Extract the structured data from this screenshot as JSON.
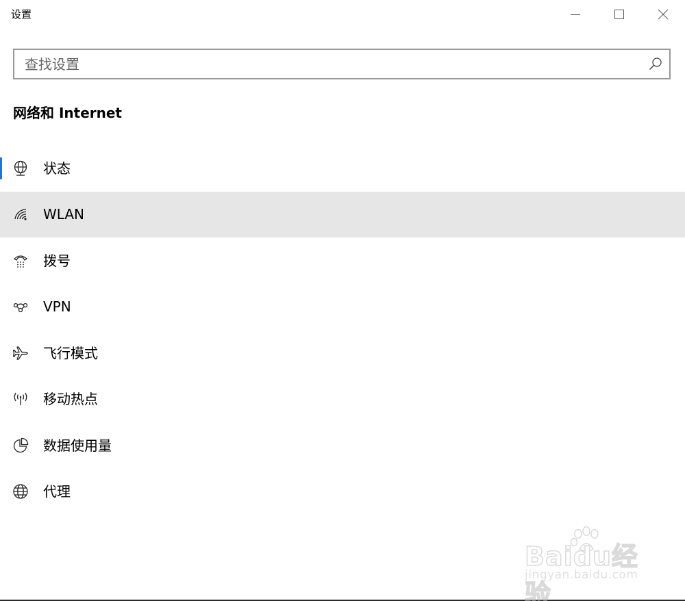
{
  "window": {
    "title": "设置",
    "controls": {
      "minimize_icon": "minimize-icon",
      "maximize_icon": "maximize-icon",
      "close_icon": "close-icon"
    }
  },
  "search": {
    "value": "",
    "placeholder": "查找设置",
    "icon": "search-icon"
  },
  "section": {
    "title": "网络和 Internet"
  },
  "nav": {
    "items": [
      {
        "label": "状态",
        "icon": "network-status-icon",
        "selected": true
      },
      {
        "label": "WLAN",
        "icon": "wifi-icon",
        "hovered": true
      },
      {
        "label": "拨号",
        "icon": "dialup-icon"
      },
      {
        "label": "VPN",
        "icon": "vpn-icon"
      },
      {
        "label": "飞行模式",
        "icon": "airplane-icon"
      },
      {
        "label": "移动热点",
        "icon": "hotspot-icon"
      },
      {
        "label": "数据使用量",
        "icon": "data-usage-icon"
      },
      {
        "label": "代理",
        "icon": "globe-icon"
      }
    ]
  },
  "watermark": {
    "logo": "Baidu经验",
    "url": "jingyan.baidu.com"
  },
  "colors": {
    "accent": "#2b73d2",
    "hover_bg": "#e6e6e6",
    "search_border": "#999999"
  }
}
